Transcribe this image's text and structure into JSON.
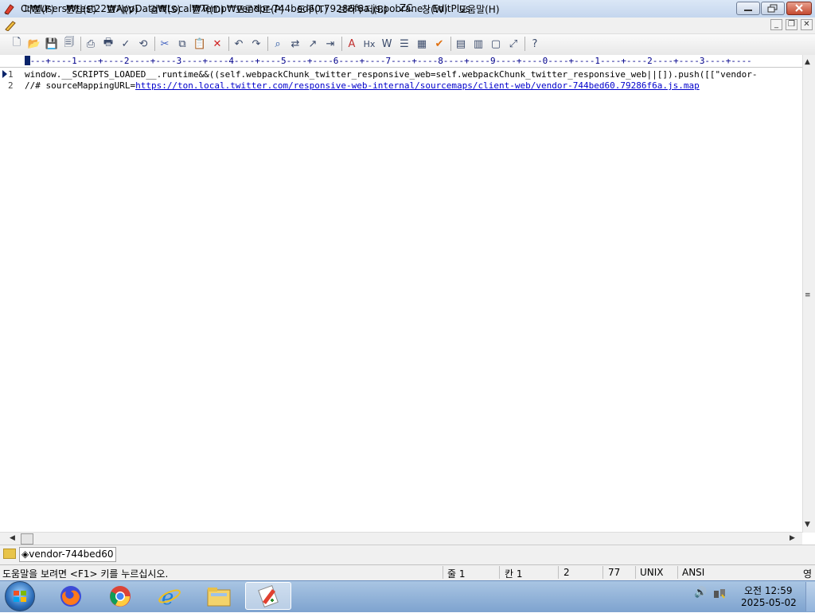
{
  "window": {
    "title": "C:₩Users₩test22₩AppData₩Local₩Temp₩vendor-744bed60.79286f6a.js.pobrane - EditPlus"
  },
  "menu": [
    {
      "name": "file",
      "label": "파일(F)"
    },
    {
      "name": "edit",
      "label": "편집(E)"
    },
    {
      "name": "view",
      "label": "보기(V)"
    },
    {
      "name": "search",
      "label": "검색(S)"
    },
    {
      "name": "document",
      "label": "문서(D)"
    },
    {
      "name": "project",
      "label": "프로젝트(P)"
    },
    {
      "name": "tools",
      "label": "도구(T)"
    },
    {
      "name": "browser",
      "label": "브라우저(B)"
    },
    {
      "name": "zc",
      "label": "ZC"
    },
    {
      "name": "window",
      "label": "창(W)"
    },
    {
      "name": "help",
      "label": "도움말(H)"
    }
  ],
  "toolbar": [
    "new-file-icon",
    "open-folder-icon",
    "save-icon",
    "save-all-icon",
    "sep",
    "print-preview-icon",
    "print-icon",
    "spellcheck-icon",
    "html-toolbar-icon",
    "sep",
    "cut-icon",
    "copy-icon",
    "paste-icon",
    "delete-icon",
    "sep",
    "undo-icon",
    "redo-icon",
    "sep",
    "find-icon",
    "replace-icon",
    "goto-icon",
    "word-wrap-icon",
    "sep",
    "font-icon",
    "hex-icon",
    "bold-w-icon",
    "indent-icon",
    "column-icon",
    "check-icon",
    "sep",
    "cliptext-icon",
    "directory-icon",
    "output-icon",
    "fullscreen-icon",
    "sep",
    "help-icon"
  ],
  "ruler": "----+----1----+----2----+----3----+----4----+----5----+----6----+----7----+----8----+----9----+----0----+----1----+----2----+----3----+----",
  "editor": {
    "lines": [
      {
        "num": "1",
        "text": "window.__SCRIPTS_LOADED__.runtime&&((self.webpackChunk_twitter_responsive_web=self.webpackChunk_twitter_responsive_web||[]).push([[\"vendor-"
      },
      {
        "num": "2",
        "prefix": "//# sourceMappingURL=",
        "url": "https://ton.local.twitter.com/responsive-web-internal/sourcemaps/client-web/vendor-744bed60.79286f6a.js.map"
      }
    ]
  },
  "tab": {
    "label": "vendor-744bed60"
  },
  "status": {
    "help_text": "도움말을 보려면 <F1> 키를 누르십시오.",
    "line": "줄 1",
    "col": "칸 1",
    "lines_count": "2",
    "size": "77",
    "eol": "UNIX",
    "encoding": "ANSI",
    "ime": "영"
  },
  "taskbar": {
    "apps": [
      "firefox",
      "chrome",
      "internet-explorer",
      "file-explorer",
      "editplus"
    ],
    "time": "오전 12:59",
    "date": "2025-05-02"
  },
  "colors": {
    "link": "#0000cc",
    "ruler": "#00008b",
    "caret": "#0a246a"
  }
}
